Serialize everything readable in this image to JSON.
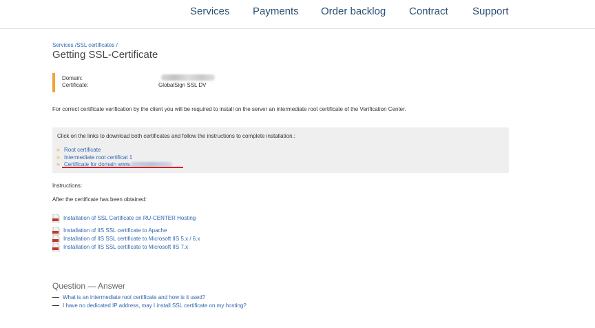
{
  "nav": {
    "items": [
      "Services",
      "Payments",
      "Order backlog",
      "Contract",
      "Support"
    ]
  },
  "breadcrumb": {
    "services": "Services",
    "sep1": " /",
    "ssl": "SSL certificates",
    "sep2": " /"
  },
  "page_title": "Getting SSL-Certificate",
  "info": {
    "domain_label": "Domain:",
    "certificate_label": "Certificate:",
    "certificate_value": "GlobalSign SSL DV"
  },
  "intro_text": "For correct certificate verification by the client you will be required to install on the server an intermediate root certificate of the Verification Center.",
  "download_box": {
    "lead": "Click on the links to download both certificates and follow the instructions to complete installation.:",
    "arrow": "»",
    "links": [
      "Root certificate",
      "Intermediate root certificat 1",
      "Certificate for domain www."
    ]
  },
  "instructions_label": "Instructions:",
  "after_label": "After the certificate has been obtained:",
  "pdf_links": [
    "Installation of SSL Certificate on RU-CENTER Hosting",
    "Installation of IIS SSL certificate to Apache",
    "Installation of IIS SSL certificate to Microsoft IIS 5.x / 6.x",
    "Installation of IIS SSL certificate to Microsoft IIS 7.x"
  ],
  "qa": {
    "title": "Question — Answer",
    "items": [
      "What is an intermediate root certificate and how is it used?",
      "I have no dedicated IP address, may I install SSL certificate on my hosting?"
    ]
  },
  "colors": {
    "accent": "#f0a33c",
    "link": "#2f67b1",
    "highlight_underline": "#d9202a",
    "pdf_icon": "#c0392b"
  },
  "icons": [
    "pdf-icon",
    "arrow-bullet-icon",
    "dash-icon"
  ]
}
